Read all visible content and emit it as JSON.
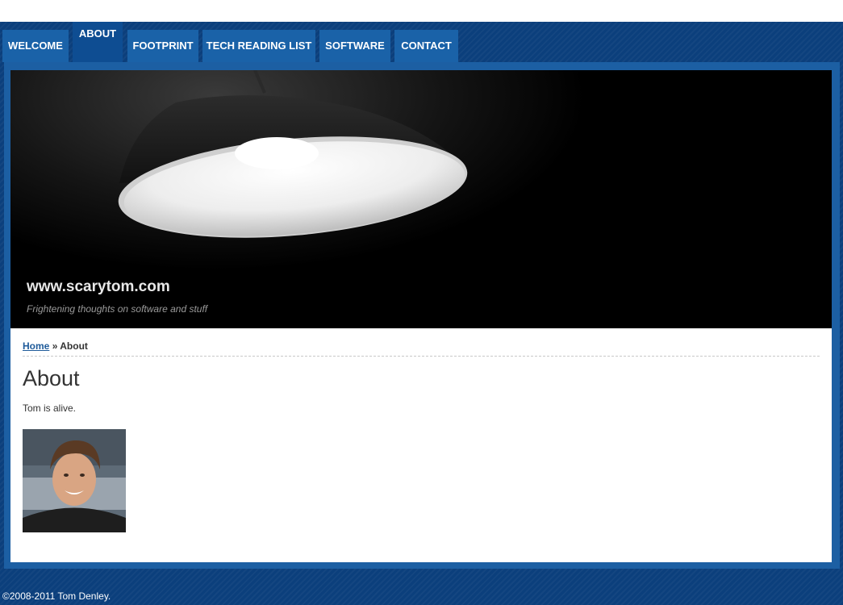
{
  "nav": {
    "items": [
      {
        "label": "WELCOME"
      },
      {
        "label": "ABOUT"
      },
      {
        "label": "FOOTPRINT"
      },
      {
        "label": "TECH READING LIST"
      },
      {
        "label": "SOFTWARE"
      },
      {
        "label": "CONTACT"
      }
    ],
    "active": "ABOUT"
  },
  "header": {
    "title": "www.scarytom.com",
    "tagline": "Frightening thoughts on software and stuff"
  },
  "breadcrumb": {
    "home": "Home",
    "separator": "»",
    "current": "About"
  },
  "main": {
    "title": "About",
    "text": "Tom is alive."
  },
  "footer": {
    "copyright": "©2008-2011 Tom Denley."
  },
  "colors": {
    "background": "#0b3f7c",
    "tab": "#1a62a8",
    "tab_active": "#0e4d92",
    "link": "#1f5b9a"
  }
}
